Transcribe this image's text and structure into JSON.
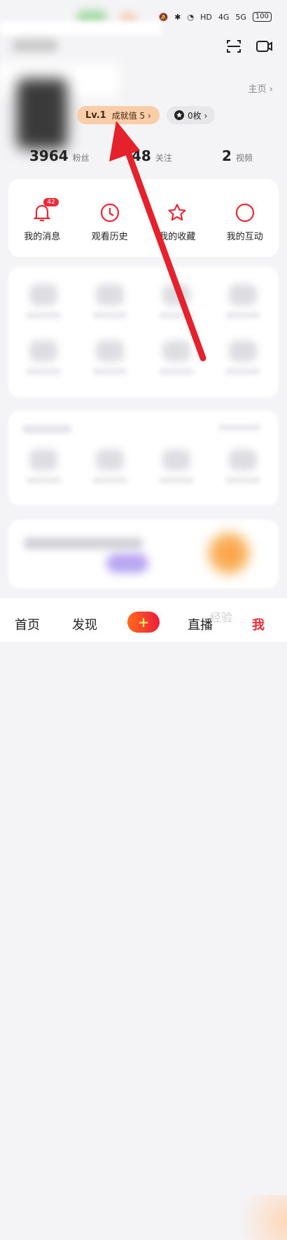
{
  "status_bar": {
    "signal_a": "4G",
    "signal_b": "5G",
    "battery": "100",
    "hd": "HD"
  },
  "profile": {
    "home_link": "主页 ›",
    "level": {
      "lv": "Lv.1",
      "label": "成就值 5 ›"
    },
    "coins": "0枚 ›"
  },
  "stats": [
    {
      "num": "3964",
      "label": "粉丝"
    },
    {
      "num": "48",
      "label": "关注"
    },
    {
      "num": "2",
      "label": "视频"
    }
  ],
  "quick_actions": [
    {
      "label": "我的消息",
      "icon": "bell-icon",
      "badge": "42"
    },
    {
      "label": "观看历史",
      "icon": "clock-icon"
    },
    {
      "label": "我的收藏",
      "icon": "star-icon"
    },
    {
      "label": "我的互动",
      "icon": "circle-icon"
    }
  ],
  "tabs": [
    "首页",
    "发现",
    "直播",
    "我"
  ],
  "plus_label": "+",
  "watermark": "经验",
  "colors": {
    "accent": "#ec2a36",
    "level_pill": "#f8cda8",
    "arrow": "#e5212c"
  }
}
